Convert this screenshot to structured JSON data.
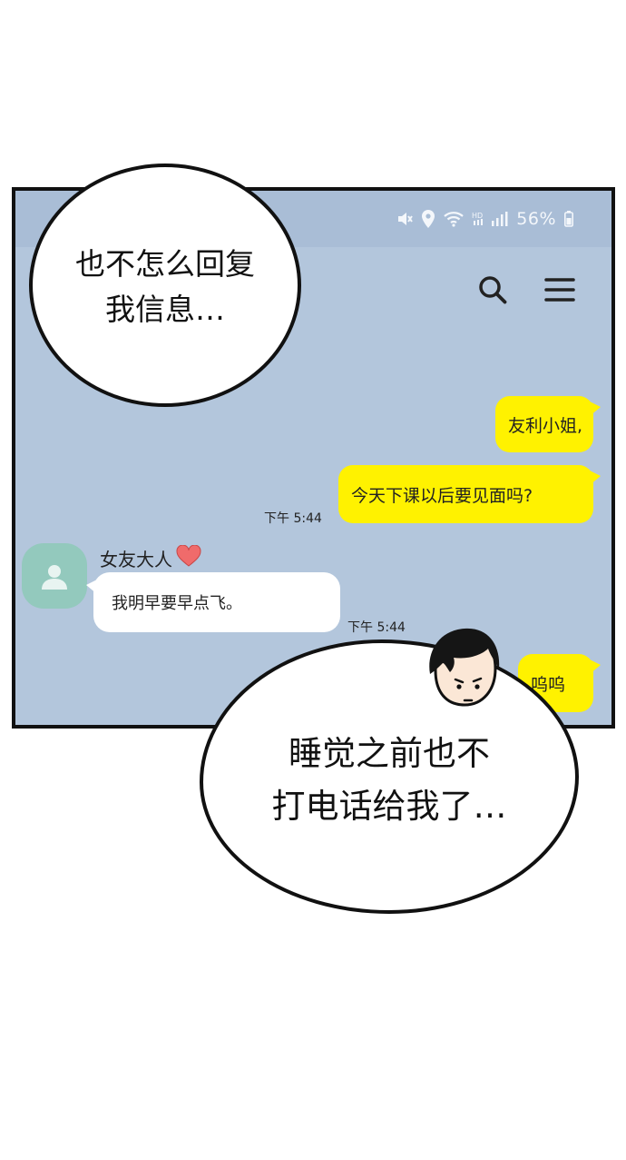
{
  "statusbar": {
    "battery_text": "56%",
    "icons": [
      "mute-icon",
      "location-icon",
      "wifi-icon",
      "hd-signal-icon",
      "battery-icon"
    ]
  },
  "header": {
    "icons": [
      "search-icon",
      "menu-icon"
    ]
  },
  "chat": {
    "contact_name": "女友大人",
    "contact_heart_icon": "heart-icon",
    "messages": [
      {
        "from": "me",
        "text": "友利小姐,"
      },
      {
        "from": "me",
        "text": "今天下课以后要见面吗?",
        "time": "下午 5:44"
      },
      {
        "from": "other",
        "text": "我明早要早点飞。",
        "time": "下午 5:44"
      },
      {
        "from": "me",
        "text": "呜呜"
      }
    ]
  },
  "speech_bubbles": {
    "top_left": {
      "line1": "也不怎么回复",
      "line2": "我信息…"
    },
    "bottom_right": {
      "line1": "睡觉之前也不",
      "line2": "打电话给我了…"
    }
  },
  "colors": {
    "chat_background": "#b3c6dc",
    "my_bubble": "#fff200",
    "other_bubble": "#ffffff",
    "avatar": "#93c9bd",
    "heart": "#f06b6b"
  }
}
